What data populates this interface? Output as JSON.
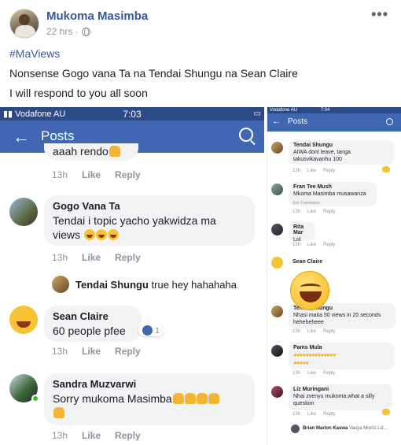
{
  "post": {
    "author": "Mukoma Masimba",
    "time": "22 hrs ·",
    "more": "•••",
    "hashtag": "#MaViews",
    "text_line1": "Nonsense Gogo vana Ta na Tendai Shungu na Sean Claire",
    "text_line2": "I will respond to you all soon"
  },
  "left_screen": {
    "status": {
      "carrier": "Vodafone AU",
      "time": "7:03"
    },
    "nav": {
      "title": "Posts"
    },
    "top_partial": {
      "text": "aaah rendo",
      "time": "13h",
      "like": "Like",
      "reply": "Reply"
    },
    "comments": [
      {
        "name": "Gogo Vana Ta",
        "text": "Tendai i topic yacho yakwidza ma views",
        "time": "13h",
        "like": "Like",
        "reply": "Reply"
      },
      {
        "name": "Sean Claire",
        "text": "60 people pfee",
        "time": "13h",
        "like": "Like",
        "reply": "Reply",
        "likes": "1"
      },
      {
        "name": "Sandra Muzvarwi",
        "text": "Sorry mukoma Masimba",
        "time": "13h",
        "like": "Like",
        "reply": "Reply"
      }
    ],
    "reply": {
      "name": "Tendai Shungu",
      "text": "true hey hahahaha"
    }
  },
  "right_screen": {
    "status": {
      "carrier": "Vodafone AU",
      "time": "7:04"
    },
    "nav": {
      "title": "Posts"
    },
    "comments": [
      {
        "name": "Tendai Shungu",
        "text": "AIWA dont leave, tanga takusvikavanhu 100",
        "time": "13h",
        "like": "Like",
        "reply": "Reply"
      },
      {
        "name": "Fran Tee Mush",
        "text": "Mkoma Masimba musawanza",
        "extra": "See Translation",
        "time": "13h",
        "like": "Like",
        "reply": "Reply"
      },
      {
        "name": "Rita Mar",
        "text": "Lol",
        "time": "13h",
        "like": "Like",
        "reply": "Reply"
      },
      {
        "name": "Sean Claire",
        "text": ""
      },
      {
        "name": "Tendai Shungu",
        "text": "Nhasi maita 50 views in 20 seconds heheheheee",
        "time": "13h",
        "like": "Like",
        "reply": "Reply"
      },
      {
        "name": "Pams Mula",
        "text": "",
        "time": "13h",
        "like": "Like",
        "reply": "Reply"
      },
      {
        "name": "Liz Muringani",
        "text": "Nhai zvenyu mukoma,what a silly question",
        "time": "13h",
        "like": "Like",
        "reply": "Reply"
      }
    ],
    "footer_reply": {
      "name": "Brian Marlon Kaswa",
      "text": "Vauya Momz Liz..."
    }
  }
}
